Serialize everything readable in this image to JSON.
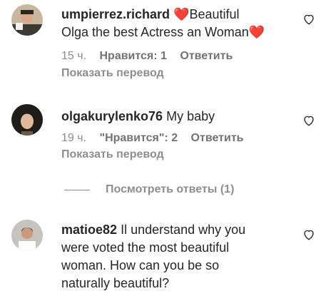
{
  "comments": [
    {
      "username": "umpierrez.richard",
      "heart_before": "❤️",
      "text_a": "Beautiful",
      "text_b": "Olga the best Actress an Woman",
      "heart_after": "❤️",
      "time": "15 ч.",
      "likes": "Нравится: 1",
      "reply": "Ответить",
      "translate": "Показать перевод"
    },
    {
      "username": "olgakurylenko76",
      "text": "My baby",
      "time": "19 ч.",
      "likes": "\"Нравится\": 2",
      "reply": "Ответить",
      "translate": "Показать перевод"
    },
    {
      "username": "matioe82",
      "text_a": "Il understand why you",
      "text_b": "were voted the most beautiful",
      "text_c": "woman. How can you be so",
      "text_d": "naturally beautiful?"
    }
  ],
  "view_replies": "Посмотреть ответы (1)",
  "colors": {
    "text": "#262626",
    "secondary": "#8e8e8e",
    "heart": "#ed1f34"
  },
  "icons": {
    "like": "heart-outline-icon"
  }
}
